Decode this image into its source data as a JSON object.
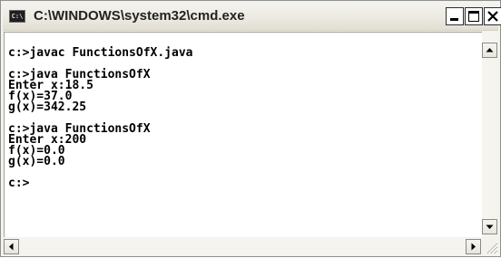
{
  "window": {
    "title": "C:\\WINDOWS\\system32\\cmd.exe",
    "icon_text": "C:\\",
    "icon": "command-prompt-icon"
  },
  "title_buttons": {
    "minimize": "minimize-icon",
    "maximize": "maximize-icon",
    "close": "close-icon"
  },
  "console": {
    "text": "c:>javac FunctionsOfX.java\n\nc:>java FunctionsOfX\nEnter x:18.5\nf(x)=37.0\ng(x)=342.25\n\nc:>java FunctionsOfX\nEnter x:200\nf(x)=0.0\ng(x)=0.0\n\nc:>"
  },
  "scrollbars": {
    "up": "arrow-up-icon",
    "down": "arrow-down-icon",
    "left": "arrow-left-icon",
    "right": "arrow-right-icon"
  },
  "colors": {
    "title_bar": "#ece9d8",
    "console_background": "#ffffff",
    "console_text": "#000000"
  }
}
